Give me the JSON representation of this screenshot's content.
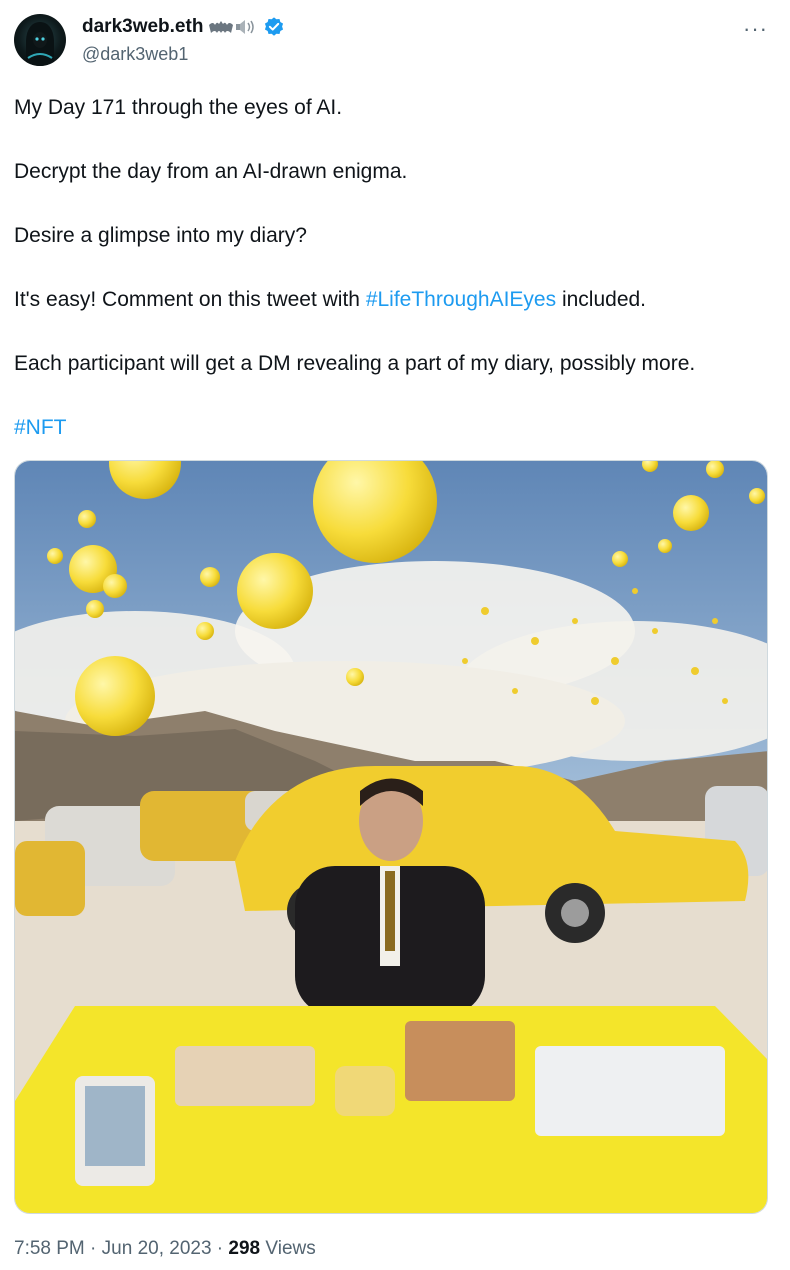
{
  "author": {
    "display_name": "dark3web.eth",
    "handle": "@dark3web1",
    "verified": true,
    "avatar_icon": "hooded-figure-avatar",
    "name_emojis": [
      "bat-icon",
      "speaker-icon"
    ]
  },
  "tweet": {
    "line1": "My Day 171 through the eyes of AI.",
    "line2": "Decrypt the day from an AI-drawn enigma.",
    "line3": "Desire a glimpse into my diary?",
    "line4_before": "It's easy! Comment on this tweet with ",
    "line4_hashtag": "#LifeThroughAIEyes",
    "line4_after": " included.",
    "line5": "Each participant will get a DM revealing a part of my diary, possibly more.",
    "hashtag_nft": "#NFT"
  },
  "media": {
    "description_icon": "ai-image"
  },
  "meta": {
    "time": "7:58 PM",
    "separator": " · ",
    "date": "Jun 20, 2023",
    "views_count": "298",
    "views_label": " Views"
  },
  "colors": {
    "link": "#1d9bf0",
    "secondary_text": "#536471",
    "verified": "#1d9bf0"
  },
  "more_label": "···"
}
